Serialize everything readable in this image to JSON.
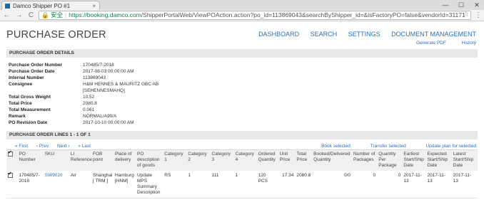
{
  "browser": {
    "tab_title": "Damco Shipper PO #1",
    "tab_close": "×",
    "secure_label": "安全",
    "url_host": "https://booking.damco.com",
    "url_path": "/ShipperPortalWeb/ViewPOAction.action?po_id=113869043&searchByShipper_id=&isFactoryPO=false&vendorId=31171",
    "back_icon": "←",
    "forward_icon": "→",
    "reload_icon": "C",
    "star_icon": "☆",
    "menu_icon": "⋮",
    "minimize": "—",
    "maximize": "☐",
    "close": "✕"
  },
  "header": {
    "title": "PURCHASE ORDER",
    "nav": [
      "DASHBOARD",
      "SEARCH",
      "SETTINGS",
      "DOCUMENT MANAGEMENT"
    ],
    "generate_pdf": "Generate PDF",
    "history": "History"
  },
  "details": {
    "section_title": "PURCHASE ORDER DETAILS",
    "rows": [
      {
        "label": "Purchase Order Number",
        "value": "170485/7-2018"
      },
      {
        "label": "Purchase Order Date",
        "value": "2017-08-03 00:00:00 AM"
      },
      {
        "label": "Internal Number",
        "value": "113869043"
      },
      {
        "label": "Consignee",
        "value": "H&M HENNES & MAURITZ GBC AB",
        "value2": "[SEHENNESMAHQ]"
      },
      {
        "label": "Total Gross Weight",
        "value": "10.52"
      },
      {
        "label": "Total Price",
        "value": "2080.8"
      },
      {
        "label": "Total Measurement",
        "value": "0.061"
      },
      {
        "label": "Remark",
        "value": "NORMAL/A90/A"
      },
      {
        "label": "PO Revision Date",
        "value": "2017-10-10 00:00:00 AM"
      }
    ]
  },
  "lines": {
    "section_title": "PURCHASE ORDER LINES  1 - 1 OF 1",
    "pager": {
      "first": "« First",
      "prev": "‹ Prev",
      "next": "Next ›",
      "last": "» Last"
    },
    "actions": [
      "Book selected",
      "Transfer selected",
      "Update plan for selected"
    ],
    "columns": [
      "PO Number",
      "SKU",
      "LI Reference",
      "FOB point",
      "Place of delivery",
      "PO description of goods",
      "Category 1",
      "Category 2",
      "Category 3",
      "Category 4",
      "Ordered Quantity",
      "Unit Price",
      "Total Price",
      "Booked/Delivered Quantity",
      "Number of Packages",
      "Quantity Per Package",
      "Earliest Start/Ship Date",
      "Expected Start/Ship Date",
      "Latest Start/Ship Date"
    ],
    "rows": [
      [
        "170485/7-2018",
        "SW9020",
        "Air",
        "Shanghai [ TRM ]",
        "Hamburg [HNM]",
        "Update MPS Summary Description",
        "RS",
        "1",
        "111",
        "1",
        "120 PCS",
        "17.34",
        "2080.8",
        "0/0",
        "0",
        "0",
        "2017-11-13",
        "2017-11-13",
        "2017-11-13"
      ]
    ]
  }
}
